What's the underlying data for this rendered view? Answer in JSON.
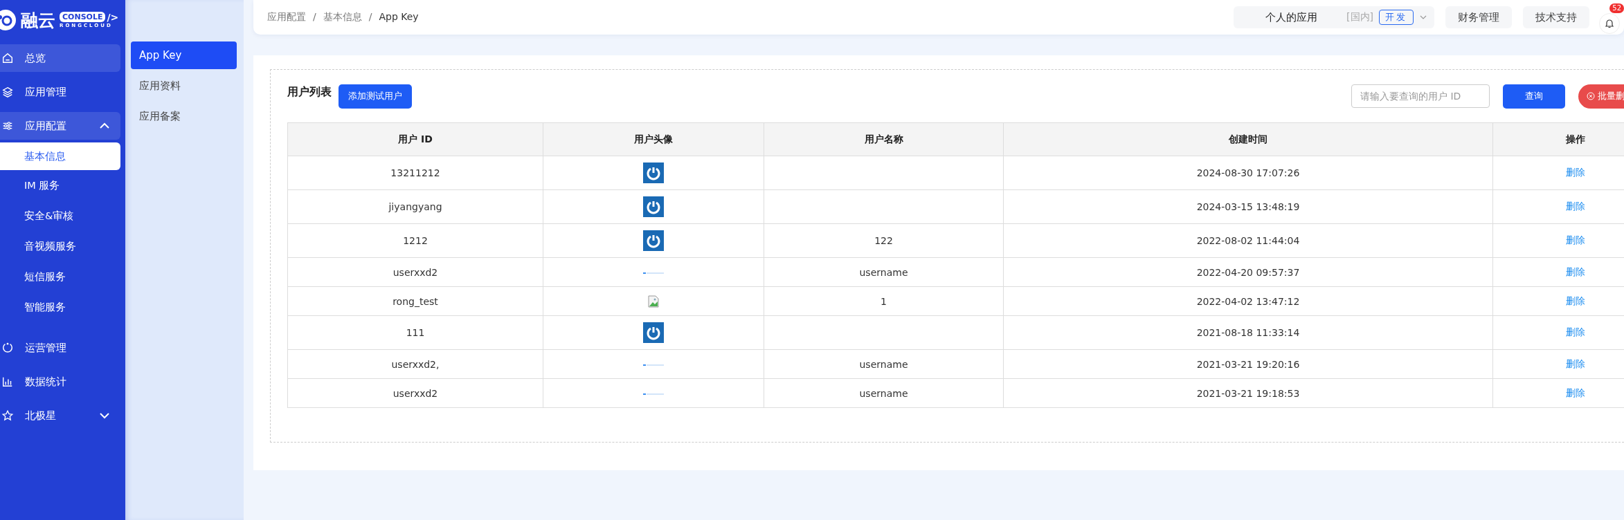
{
  "logo": {
    "name": "融云",
    "badge": "CONSOLE",
    "mark": "/>",
    "subtitle": "RONGCLOUD"
  },
  "sidebar": {
    "items": [
      {
        "label": "总览",
        "highlighted": true
      },
      {
        "label": "应用管理",
        "highlighted": false
      },
      {
        "label": "应用配置",
        "highlighted": true,
        "expanded": true,
        "children": [
          {
            "label": "基本信息",
            "selected": true
          },
          {
            "label": "IM 服务",
            "selected": false
          },
          {
            "label": "安全&审核",
            "selected": false
          },
          {
            "label": "音视频服务",
            "selected": false
          },
          {
            "label": "短信服务",
            "selected": false
          },
          {
            "label": "智能服务",
            "selected": false
          }
        ]
      },
      {
        "label": "运营管理",
        "highlighted": false
      },
      {
        "label": "数据统计",
        "highlighted": false
      },
      {
        "label": "北极星",
        "highlighted": false,
        "expanded": false
      }
    ]
  },
  "subnav": {
    "items": [
      {
        "label": "App Key",
        "selected": true
      },
      {
        "label": "应用资料",
        "selected": false
      },
      {
        "label": "应用备案",
        "selected": false
      }
    ]
  },
  "topbar": {
    "breadcrumb": [
      "应用配置",
      "基本信息",
      "App Key"
    ],
    "separator": "/",
    "app_switcher": {
      "name": "个人的应用",
      "region": "[国内]",
      "env": "开发"
    },
    "buttons": [
      "财务管理",
      "技术支持"
    ],
    "notifications": {
      "count": "52"
    }
  },
  "user_list": {
    "title": "用户列表",
    "add_button": "添加测试用户",
    "search": {
      "placeholder": "请输入要查询的用户 ID"
    },
    "query_button": "查询",
    "batch_delete_button": "批量删",
    "table": {
      "columns": [
        "用户 ID",
        "用户头像",
        "用户名称",
        "创建时间",
        "操作"
      ],
      "rows": [
        {
          "user_id": "13211212",
          "avatar": {
            "kind": "logo"
          },
          "username": "",
          "created": "2024-08-30 17:07:26",
          "action": "删除"
        },
        {
          "user_id": "jiyangyang",
          "avatar": {
            "kind": "logo"
          },
          "username": "",
          "created": "2024-03-15 13:48:19",
          "action": "删除"
        },
        {
          "user_id": "1212",
          "avatar": {
            "kind": "logo"
          },
          "username": "122",
          "created": "2022-08-02 11:44:04",
          "action": "删除"
        },
        {
          "user_id": "userxxd2",
          "avatar": {
            "kind": "banner"
          },
          "username": "username",
          "created": "2022-04-20 09:57:37",
          "action": "删除"
        },
        {
          "user_id": "rong_test",
          "avatar": {
            "kind": "broken"
          },
          "username": "1",
          "created": "2022-04-02 13:47:12",
          "action": "删除"
        },
        {
          "user_id": "111",
          "avatar": {
            "kind": "logo"
          },
          "username": "",
          "created": "2021-08-18 11:33:14",
          "action": "删除"
        },
        {
          "user_id": "userxxd2,",
          "avatar": {
            "kind": "banner"
          },
          "username": "username",
          "created": "2021-03-21 19:20:16",
          "action": "删除"
        },
        {
          "user_id": "userxxd2",
          "avatar": {
            "kind": "banner"
          },
          "username": "username",
          "created": "2021-03-21 19:18:53",
          "action": "删除"
        }
      ]
    }
  }
}
